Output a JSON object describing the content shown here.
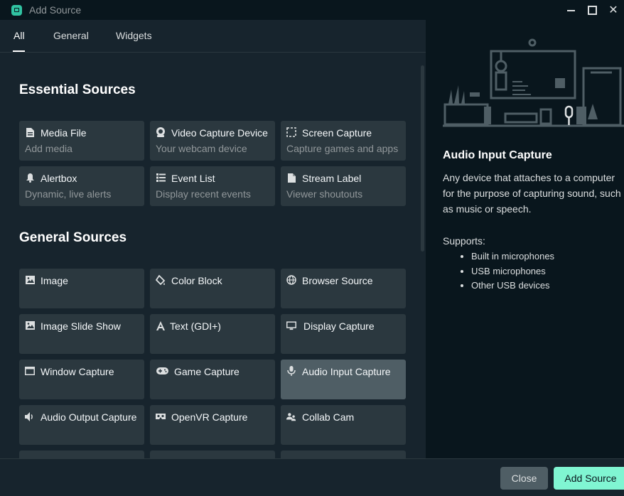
{
  "window": {
    "title": "Add Source"
  },
  "tabs": [
    {
      "label": "All",
      "active": true
    },
    {
      "label": "General"
    },
    {
      "label": "Widgets"
    }
  ],
  "essential": {
    "title": "Essential Sources",
    "items": [
      {
        "name": "Media File",
        "desc": "Add media",
        "icon": "file-icon"
      },
      {
        "name": "Video Capture Device",
        "desc": "Your webcam device",
        "icon": "webcam-icon"
      },
      {
        "name": "Screen Capture",
        "desc": "Capture games and apps",
        "icon": "screen-select-icon"
      },
      {
        "name": "Alertbox",
        "desc": "Dynamic, live alerts",
        "icon": "bell-icon"
      },
      {
        "name": "Event List",
        "desc": "Display recent events",
        "icon": "list-icon"
      },
      {
        "name": "Stream Label",
        "desc": "Viewer shoutouts",
        "icon": "label-file-icon"
      }
    ]
  },
  "general": {
    "title": "General Sources",
    "items": [
      {
        "name": "Image",
        "icon": "image-icon"
      },
      {
        "name": "Color Block",
        "icon": "paint-bucket-icon"
      },
      {
        "name": "Browser Source",
        "icon": "globe-icon"
      },
      {
        "name": "Image Slide Show",
        "icon": "image-icon"
      },
      {
        "name": "Text (GDI+)",
        "icon": "text-icon"
      },
      {
        "name": "Display Capture",
        "icon": "monitor-icon"
      },
      {
        "name": "Window Capture",
        "icon": "window-icon"
      },
      {
        "name": "Game Capture",
        "icon": "gamepad-icon"
      },
      {
        "name": "Audio Input Capture",
        "icon": "microphone-icon",
        "selected": true
      },
      {
        "name": "Audio Output Capture",
        "icon": "speaker-icon"
      },
      {
        "name": "OpenVR Capture",
        "icon": "vr-icon"
      },
      {
        "name": "Collab Cam",
        "icon": "users-icon"
      }
    ]
  },
  "detail": {
    "title": "Audio Input Capture",
    "description": "Any device that attaches to a computer for the purpose of capturing sound, such as music or speech.",
    "supports_label": "Supports:",
    "supports": [
      "Built in microphones",
      "USB microphones",
      "Other USB devices"
    ]
  },
  "footer": {
    "close_label": "Close",
    "add_label": "Add Source"
  },
  "colors": {
    "accent": "#80f5d2",
    "selected_card": "#4f5e65",
    "card": "#2b383f"
  }
}
